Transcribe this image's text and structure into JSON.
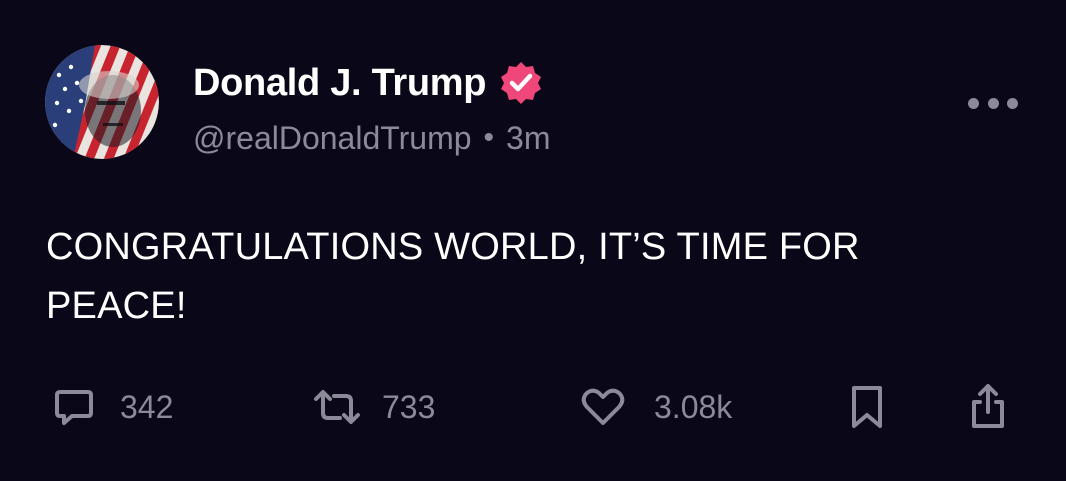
{
  "post": {
    "author": {
      "display_name": "Donald J. Trump",
      "handle": "@realDonaldTrump",
      "verified": true,
      "verified_color": "#f0477a"
    },
    "separator": "•",
    "time_ago": "3m",
    "text_lines": [
      "CONGRATULATIONS WORLD, IT’S TIME FOR",
      "PEACE!"
    ],
    "actions": {
      "replies": {
        "icon": "comment-icon",
        "count": "342"
      },
      "reposts": {
        "icon": "repost-icon",
        "count": "733"
      },
      "likes": {
        "icon": "heart-icon",
        "count": "3.08k"
      },
      "bookmark": {
        "icon": "bookmark-icon"
      },
      "share": {
        "icon": "share-icon"
      }
    },
    "more_icon": "more-horizontal-icon"
  },
  "colors": {
    "background": "#0a0818",
    "primary_text": "#ffffff",
    "secondary_text": "#8b8a98",
    "icon": "#8b8a98"
  }
}
